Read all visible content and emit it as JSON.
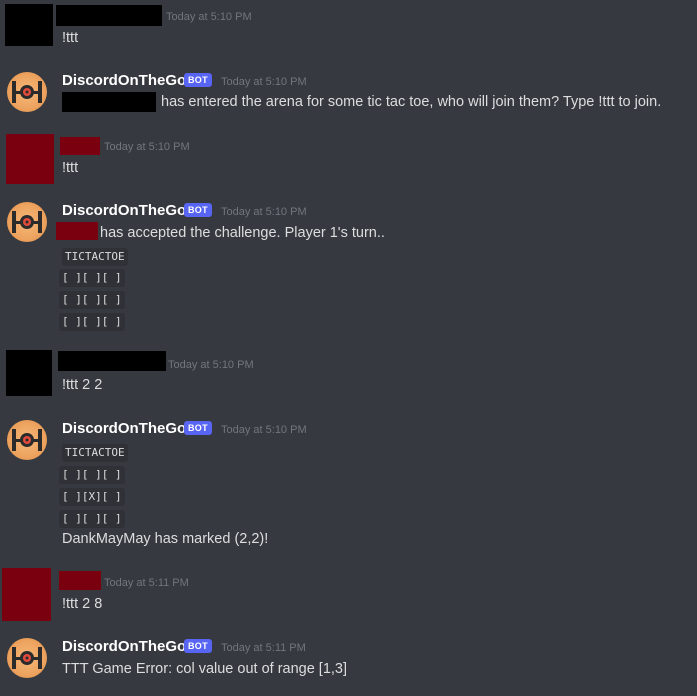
{
  "messages": [
    {
      "time": "Today at 5:10 PM",
      "text": "!ttt"
    },
    {
      "username": "DiscordOnTheGo",
      "bot_tag": "BOT",
      "time": "Today at 5:10 PM",
      "text": "has entered the arena for some tic tac toe, who will join them? Type !ttt to join."
    },
    {
      "time": "Today at 5:10 PM",
      "text": "!ttt"
    },
    {
      "username": "DiscordOnTheGo",
      "bot_tag": "BOT",
      "time": "Today at 5:10 PM",
      "text": "has accepted the challenge. Player 1's turn..",
      "board": [
        "TICTACTOE",
        "[ ][ ][ ]",
        "[ ][ ][ ]",
        "[ ][ ][ ]"
      ]
    },
    {
      "time": "Today at 5:10 PM",
      "text": "!ttt 2 2"
    },
    {
      "username": "DiscordOnTheGo",
      "bot_tag": "BOT",
      "time": "Today at 5:10 PM",
      "board": [
        "TICTACTOE",
        "[ ][ ][ ]",
        "[ ][X][ ]",
        "[ ][ ][ ]"
      ],
      "text": "DankMayMay has marked (2,2)!"
    },
    {
      "time": "Today at 5:11 PM",
      "text": "!ttt 2 8"
    },
    {
      "username": "DiscordOnTheGo",
      "bot_tag": "BOT",
      "time": "Today at 5:11 PM",
      "text": "TTT Game Error: col value out of range [1,3]"
    }
  ],
  "colors": {
    "background": "#36393f",
    "username": "#ffffff",
    "text": "#dcddde",
    "timestamp": "#72767d",
    "bot_tag": "#5865f2",
    "redaction_black": "#000000",
    "redaction_red": "#7a0010",
    "code_background": "#2f3136"
  }
}
